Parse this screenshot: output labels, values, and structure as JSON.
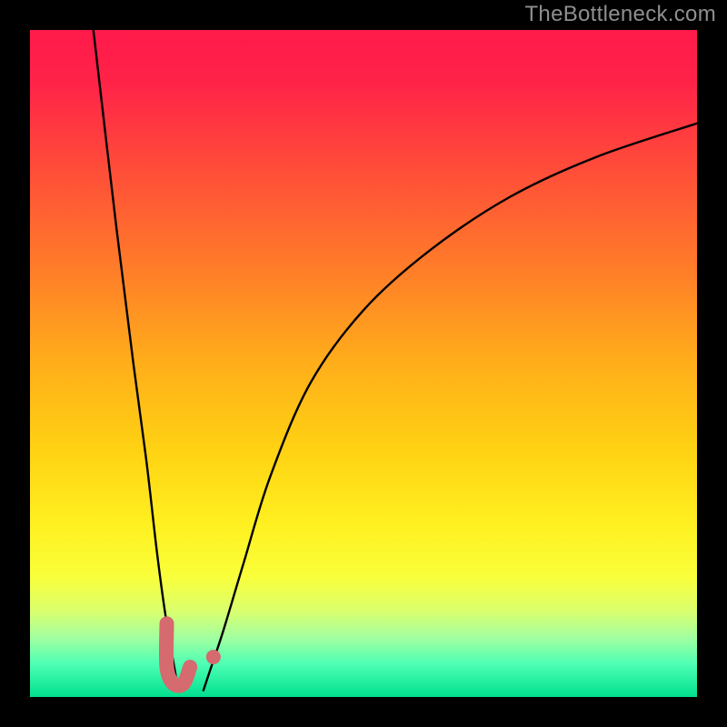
{
  "watermark": "TheBottleneck.com",
  "chart_data": {
    "type": "line",
    "title": "",
    "xlabel": "",
    "ylabel": "",
    "xlim": [
      0,
      100
    ],
    "ylim": [
      0,
      100
    ],
    "gradient_stops": [
      {
        "offset": 0.0,
        "color": "#ff1a4b"
      },
      {
        "offset": 0.08,
        "color": "#ff2348"
      },
      {
        "offset": 0.2,
        "color": "#ff4a3a"
      },
      {
        "offset": 0.35,
        "color": "#ff7a2a"
      },
      {
        "offset": 0.5,
        "color": "#ffae1a"
      },
      {
        "offset": 0.63,
        "color": "#ffd213"
      },
      {
        "offset": 0.74,
        "color": "#fff020"
      },
      {
        "offset": 0.82,
        "color": "#f9ff3a"
      },
      {
        "offset": 0.87,
        "color": "#dbff6d"
      },
      {
        "offset": 0.91,
        "color": "#a4ff9f"
      },
      {
        "offset": 0.95,
        "color": "#4fffb4"
      },
      {
        "offset": 1.0,
        "color": "#00e08f"
      }
    ],
    "series": [
      {
        "name": "left-branch",
        "x": [
          9.5,
          13.0,
          15.5,
          17.5,
          19.0,
          20.2,
          21.2,
          21.9,
          22.4
        ],
        "y": [
          100,
          70,
          50,
          35,
          22,
          13,
          7,
          3,
          1
        ]
      },
      {
        "name": "right-branch",
        "x": [
          26.0,
          27.0,
          29.0,
          32.0,
          36.0,
          42.0,
          50.0,
          60.0,
          72.0,
          85.0,
          100.0
        ],
        "y": [
          1,
          4,
          10,
          20,
          33,
          47,
          58,
          67,
          75,
          81,
          86
        ]
      },
      {
        "name": "marker-hook",
        "x": [
          20.5,
          20.5,
          21.5,
          23.0,
          24.0
        ],
        "y": [
          11.0,
          4.5,
          2.0,
          2.0,
          4.5
        ]
      },
      {
        "name": "marker-dot",
        "x": [
          27.5
        ],
        "y": [
          6.0
        ]
      }
    ],
    "marker_color": "#d56a6f"
  }
}
